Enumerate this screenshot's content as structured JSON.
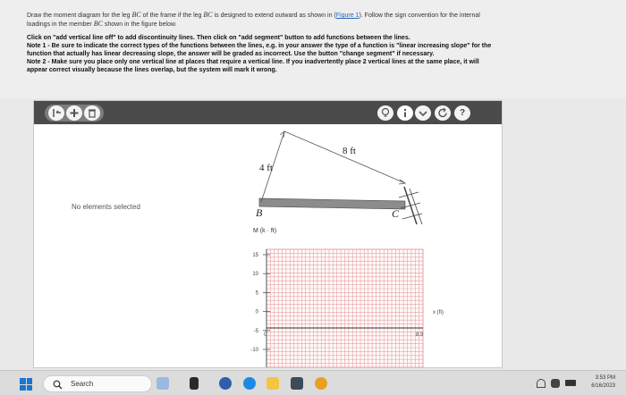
{
  "problem": {
    "line1_a": "Draw the moment diagram for the leg ",
    "member": "BC",
    "line1_b": " of the frame if the leg ",
    "line1_c": " is designed to extend outward as shown in (",
    "figure_link": "Figure 1",
    "line1_d": "). Follow the sign convention for the internal",
    "line2_a": "loadings in the member ",
    "line2_b": " shown in the figure below.",
    "instr1": "Click on \"add vertical line off\" to add discontinuity lines. Then click on \"add segment\" button to add functions between the lines.",
    "instr2": "Note 1 - Be sure to indicate the correct types of the functions between the lines, e.g. in your answer the type of a function is \"linear increasing slope\" for the",
    "instr3": "function that actually has linear decreasing slope, the answer will be graded as incorrect. Use the button \"change segment\" if necessary.",
    "instr4": "Note 2 - Make sure you place only one vertical line at places that require a vertical line. If you inadvertently place 2 vertical lines at the same place, it will",
    "instr5": "appear correct visually because the lines overlap, but the system will mark it wrong."
  },
  "toolbar": {
    "left_icons": [
      "vertical-line-icon",
      "plus-icon",
      "trash-icon"
    ],
    "right_icons": [
      "lightbulb-icon",
      "info-icon",
      "chevron-down-icon",
      "refresh-icon",
      "help-icon"
    ]
  },
  "panel": {
    "status": "No elements selected"
  },
  "figure": {
    "dim_4ft": "4 ft",
    "dim_8ft": "8 ft",
    "label_b": "B",
    "label_c": "C",
    "y_axis_label": "M (k · ft)",
    "x_axis_label": "x (ft)",
    "y_ticks": [
      "15",
      "10",
      "5",
      "0",
      "-5",
      "-10"
    ],
    "x_start": "0",
    "x_end": "8.9"
  },
  "taskbar": {
    "search_placeholder": "Search",
    "time": "3:53 PM",
    "date": "6/16/2023"
  }
}
